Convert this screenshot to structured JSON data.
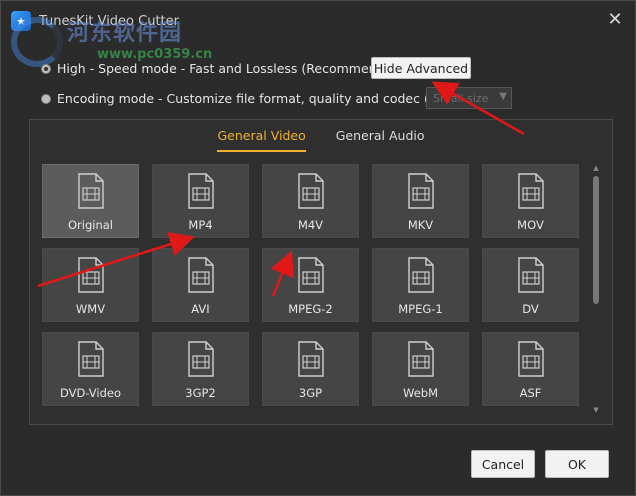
{
  "window": {
    "title": "TunesKit Video Cutter",
    "logo_glyph": "★"
  },
  "watermark": {
    "cn": "河东软件园",
    "url": "www.pc0359.cn"
  },
  "modes": {
    "high_speed": "High - Speed mode - Fast and Lossless (Recommended)",
    "encoding": "Encoding mode - Customize file format, quality and codec (Slow)",
    "hide_advanced_label": "Hide Advanced",
    "quality_value": "Small size"
  },
  "tabs": [
    {
      "label": "General Video",
      "active": true
    },
    {
      "label": "General Audio",
      "active": false
    }
  ],
  "formats": [
    {
      "label": "Original",
      "selected": true
    },
    {
      "label": "MP4"
    },
    {
      "label": "M4V"
    },
    {
      "label": "MKV"
    },
    {
      "label": "MOV"
    },
    {
      "label": "WMV"
    },
    {
      "label": "AVI"
    },
    {
      "label": "MPEG-2"
    },
    {
      "label": "MPEG-1"
    },
    {
      "label": "DV"
    },
    {
      "label": "DVD-Video"
    },
    {
      "label": "3GP2"
    },
    {
      "label": "3GP"
    },
    {
      "label": "WebM"
    },
    {
      "label": "ASF"
    }
  ],
  "footer": {
    "cancel_label": "Cancel",
    "ok_label": "OK"
  },
  "colors": {
    "accent": "#f0b030",
    "annotation_arrow": "#e01818"
  }
}
